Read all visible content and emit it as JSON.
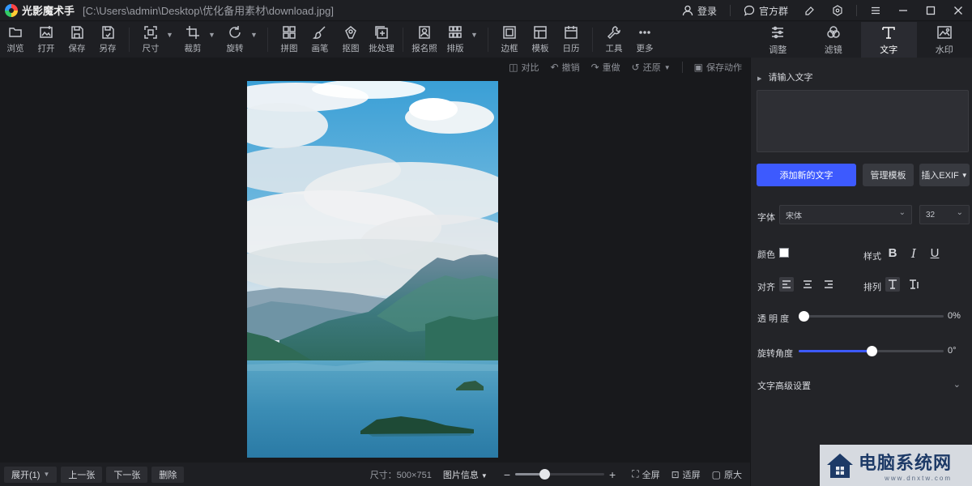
{
  "titlebar": {
    "app_name": "光影魔术手",
    "file_path": "[C:\\Users\\admin\\Desktop\\优化备用素材\\download.jpg]",
    "login": "登录",
    "group": "官方群"
  },
  "toolbar": {
    "tools": [
      {
        "label": "浏览",
        "icon": "folder-icon"
      },
      {
        "label": "打开",
        "icon": "open-image-icon"
      },
      {
        "label": "保存",
        "icon": "save-icon"
      },
      {
        "label": "另存",
        "icon": "save-as-icon"
      },
      {
        "label": "尺寸",
        "icon": "resize-icon"
      },
      {
        "label": "裁剪",
        "icon": "crop-icon"
      },
      {
        "label": "旋转",
        "icon": "rotate-icon"
      },
      {
        "label": "拼图",
        "icon": "collage-icon"
      },
      {
        "label": "画笔",
        "icon": "brush-icon"
      },
      {
        "label": "抠图",
        "icon": "cutout-icon"
      },
      {
        "label": "批处理",
        "icon": "batch-icon"
      },
      {
        "label": "报名照",
        "icon": "id-photo-icon"
      },
      {
        "label": "排版",
        "icon": "layout-icon"
      },
      {
        "label": "边框",
        "icon": "border-icon"
      },
      {
        "label": "模板",
        "icon": "template-icon"
      },
      {
        "label": "日历",
        "icon": "calendar-icon"
      },
      {
        "label": "工具",
        "icon": "wrench-icon"
      },
      {
        "label": "更多",
        "icon": "more-icon"
      }
    ]
  },
  "right_tabs": [
    {
      "label": "调整",
      "icon": "sliders-icon"
    },
    {
      "label": "滤镜",
      "icon": "filter-icon"
    },
    {
      "label": "文字",
      "icon": "text-icon"
    },
    {
      "label": "水印",
      "icon": "watermark-icon"
    }
  ],
  "canvas_tools": {
    "compare": "对比",
    "undo": "撤销",
    "redo": "重做",
    "restore": "还原",
    "save_action": "保存动作"
  },
  "bottom": {
    "expand": "展开(1)",
    "prev": "上一张",
    "next": "下一张",
    "delete": "删除",
    "size_info": "尺寸：500×751",
    "image_info": "图片信息",
    "zoom_level": 0.33,
    "fullscreen": "全屏",
    "fit": "适屏",
    "original": "原大"
  },
  "text_panel": {
    "section_title": "请输入文字",
    "input_value": "",
    "add_button": "添加新的文字",
    "manage_button": "管理模板",
    "exif_button": "插入EXIF",
    "font_label": "字体",
    "font_value": "宋体",
    "size_value": "32",
    "color_label": "颜色",
    "color_value": "#ffffff",
    "style_label": "样式",
    "style_bold": "B",
    "style_italic": "I",
    "style_underline": "U",
    "align_label": "对齐",
    "arrange_label": "排列",
    "opacity_label": "透 明 度",
    "opacity_value": "0%",
    "opacity_level": 0,
    "rotation_label": "旋转角度",
    "rotation_value": "0°",
    "rotation_level": 0.5,
    "advanced": "文字高级设置"
  },
  "colors": {
    "accent": "#3d5afe",
    "background": "#18191c",
    "panel": "#232428"
  },
  "watermark": {
    "main": "电脑系统网",
    "sub": "www.dnxtw.com"
  }
}
